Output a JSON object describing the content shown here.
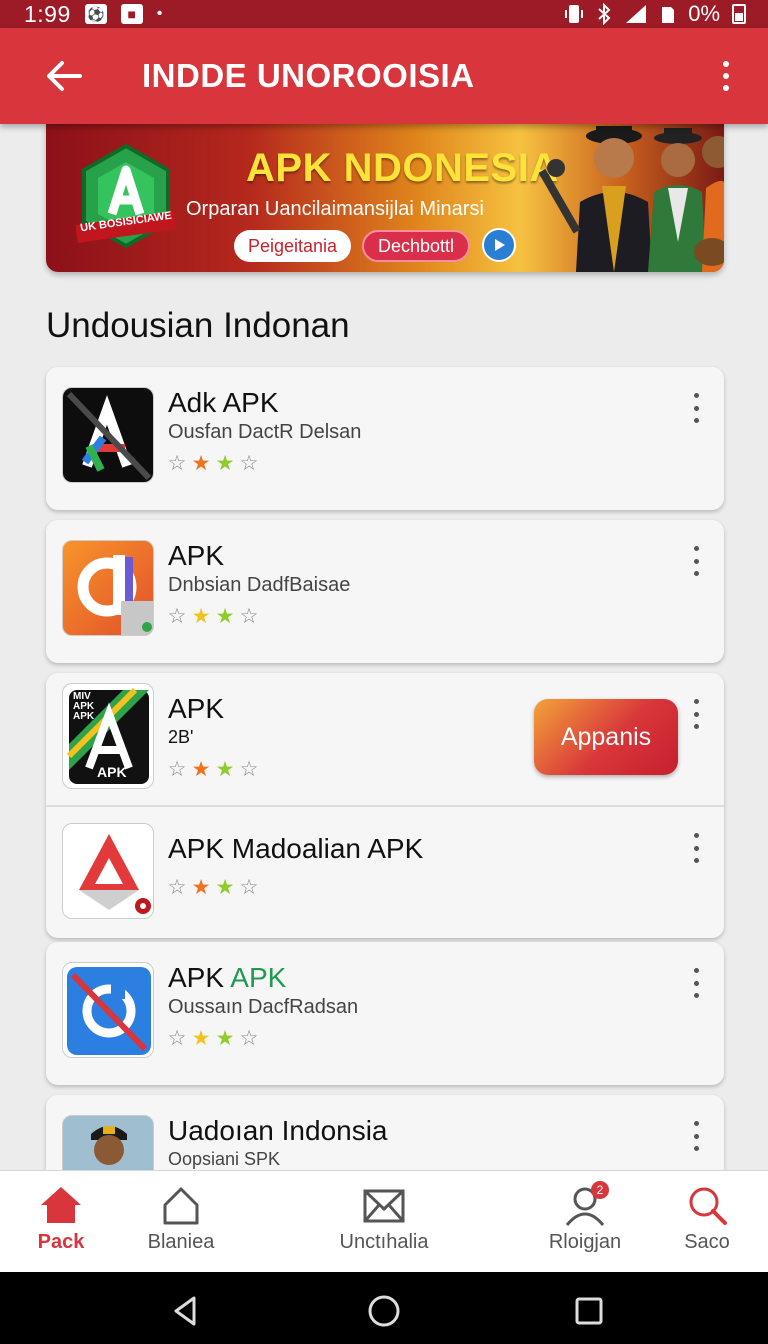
{
  "status_bar": {
    "time": "1:99",
    "battery_text": "0%"
  },
  "app_bar": {
    "title": "INDDE UNOROOISIA"
  },
  "banner": {
    "logo_caption": "UK BOSISICIAWE",
    "title": "APK NDONESIA",
    "subtitle": "Orparan Uancilaimansijlai Minarsi",
    "primary_label": "Peigeitania",
    "secondary_label": "Dechbottl"
  },
  "section": {
    "title": "Undousian Indonan"
  },
  "apps": [
    {
      "name": "Adk APK",
      "subtitle": "Ousfan DactR Delsan",
      "stars": [
        "empty",
        "orange",
        "green",
        "empty"
      ]
    },
    {
      "name": "APK",
      "subtitle": "Dnbsian DadfBaisae",
      "stars": [
        "empty",
        "yellow",
        "green",
        "empty"
      ]
    },
    {
      "name": "APK",
      "subtitle": "2B'",
      "stars": [
        "empty",
        "orange",
        "green",
        "empty"
      ],
      "action_label": "Appanis",
      "icon_text_top": "MIV APK APK",
      "icon_text_bottom": "APK"
    },
    {
      "name": "APK Madoalian  APK",
      "subtitle": "",
      "stars": [
        "empty",
        "orange",
        "green",
        "empty"
      ]
    },
    {
      "name_prefix": "APK ",
      "name_accent": "APK",
      "accent_color": "#1f9a4e",
      "subtitle": "Oussaın DacfRadsan",
      "stars": [
        "empty",
        "yellow",
        "green",
        "empty"
      ]
    },
    {
      "name": "Uadoıan Indonsia",
      "subtitle": "Oopsiani SPK"
    }
  ],
  "bottom_nav": [
    {
      "label": "Pack",
      "icon": "home-filled-icon",
      "active": true
    },
    {
      "label": "Blaniea",
      "icon": "home-outline-icon"
    },
    {
      "label": "Unctıhalia",
      "icon": "mail-icon"
    },
    {
      "label": "Rloigjan",
      "icon": "profile-icon",
      "badge": "2"
    },
    {
      "label": "Saco",
      "icon": "search-icon"
    }
  ],
  "colors": {
    "primary": "#d8353c",
    "status_bar": "#9d1b26",
    "accent_green": "#1f9a4e",
    "banner_yellow": "#ffe23a"
  }
}
